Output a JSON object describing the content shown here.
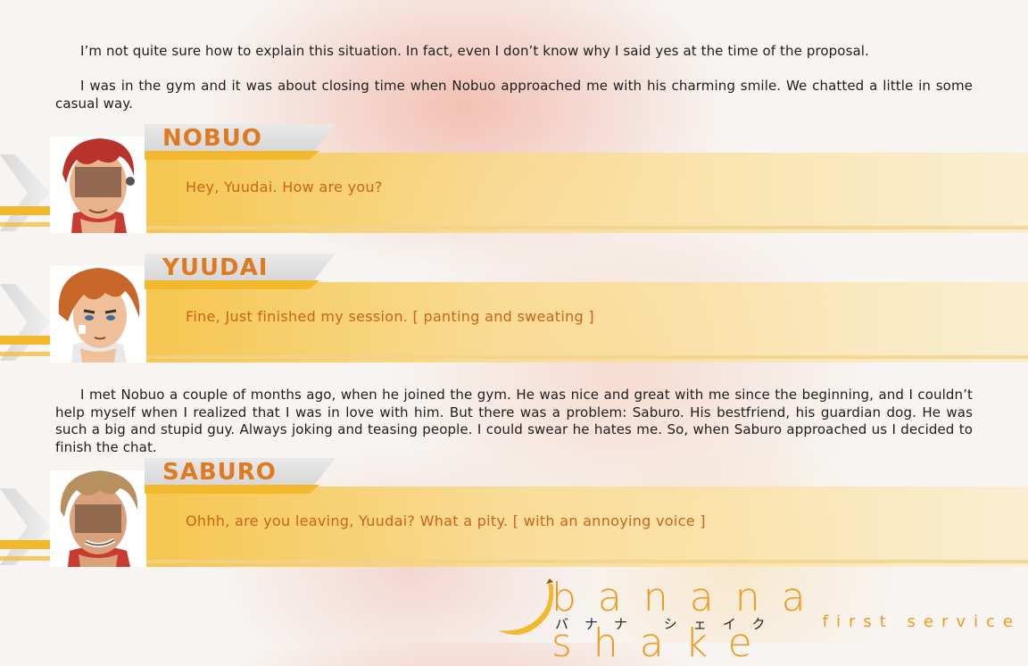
{
  "narration": [
    "I’m not quite sure how to explain this situation. In fact, even I don’t know why I said yes at the time of the proposal.",
    "I was in the gym and it was about closing time when Nobuo approached me with his charming smile. We chatted a little in some casual way.",
    "I met Nobuo a couple of months ago, when he joined the gym. He was nice and great with me since the beginning, and I couldn’t help myself when I realized that I was in love with him. But there was a problem: Saburo. His bestfriend, his guardian dog. He was such a big and stupid guy. Always joking and teasing people. I could swear he hates me. So, when Saburo approached us I decided to finish the chat."
  ],
  "dialogs": [
    {
      "name": "NOBUO",
      "text": "Hey, Yuudai. How are you?",
      "hair": "#b8332a",
      "skin": "#e9b38c"
    },
    {
      "name": "YUUDAI",
      "text": "Fine, Just finished my session. [ panting and sweating ]",
      "hair": "#c9662a",
      "skin": "#f0c09a"
    },
    {
      "name": "SABURO",
      "text": "Ohhh, are you leaving, Yuudai? What a pity. [ with an annoying voice ]",
      "hair": "#b89060",
      "skin": "#d9a27c"
    }
  ],
  "logo": {
    "title": "banana shake",
    "japanese": "バナナ シェイク",
    "subtitle": "first service"
  },
  "colors": {
    "accent": "#f3b92d",
    "name": "#e07a20",
    "speech": "#c9641a"
  }
}
